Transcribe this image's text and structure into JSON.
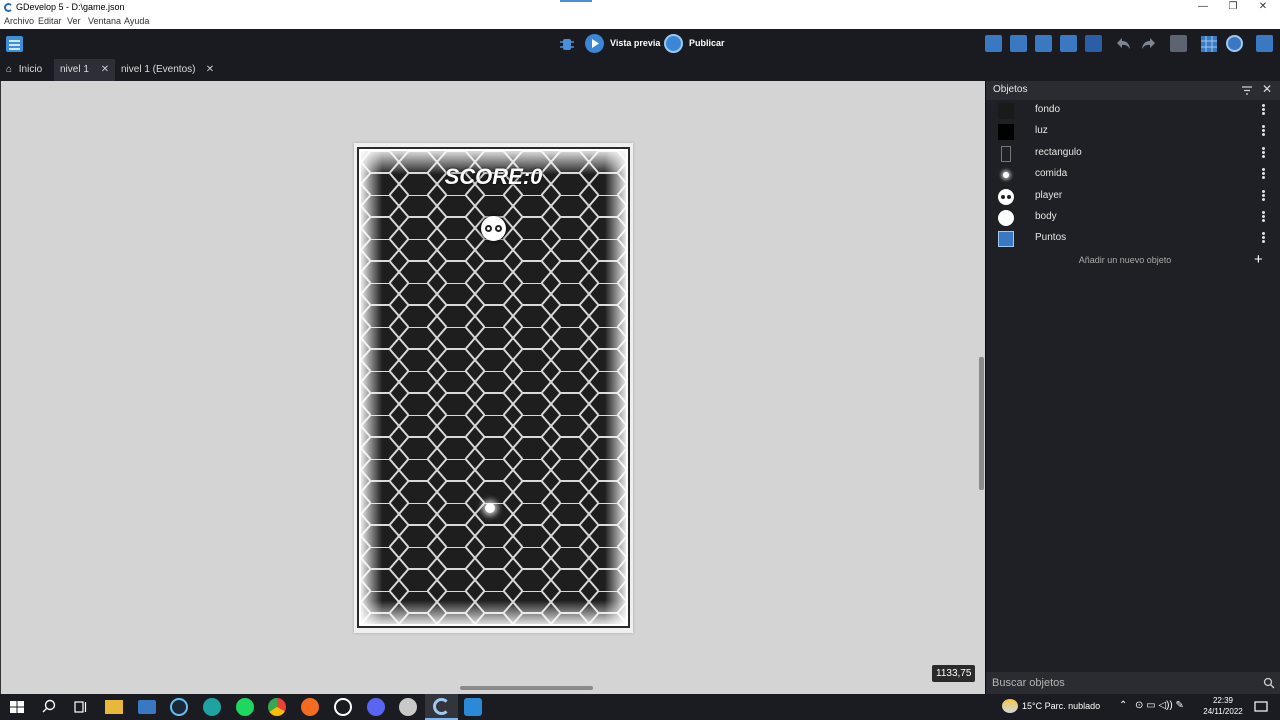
{
  "window": {
    "title": "GDevelop 5 - D:\\game.json",
    "minimize": "—",
    "maximize": "❐",
    "close": "✕"
  },
  "menu": {
    "items": [
      "Archivo",
      "Editar",
      "Ver",
      "Ventana",
      "Ayuda"
    ]
  },
  "toolbar": {
    "preview_label": "Vista previa",
    "publish_label": "Publicar"
  },
  "tabs": [
    {
      "label": "Inicio",
      "icon": "home-icon"
    },
    {
      "label": "nivel 1",
      "active": true
    },
    {
      "label": "nivel 1 (Eventos)"
    }
  ],
  "scene": {
    "score_text": "SCORE:0",
    "coordinates": "1133,75"
  },
  "objects_panel": {
    "title": "Objetos",
    "objects": [
      {
        "name": "fondo",
        "thumb": "dark"
      },
      {
        "name": "luz",
        "thumb": "black-square"
      },
      {
        "name": "rectangulo",
        "thumb": "outline-rect"
      },
      {
        "name": "comida",
        "thumb": "glow-dot"
      },
      {
        "name": "player",
        "thumb": "eyes-circle"
      },
      {
        "name": "body",
        "thumb": "white-circle"
      },
      {
        "name": "Puntos",
        "thumb": "text-icon"
      }
    ],
    "add_label": "Añadir un nuevo objeto",
    "search_placeholder": "Buscar objetos"
  },
  "taskbar": {
    "weather": "15°C  Parc. nublado",
    "time": "22:39",
    "date": "24/11/2022"
  },
  "colors": {
    "accent": "#3f8fd8",
    "toolbar_bg": "#1a1b20",
    "panel_bg": "#1f2025"
  }
}
